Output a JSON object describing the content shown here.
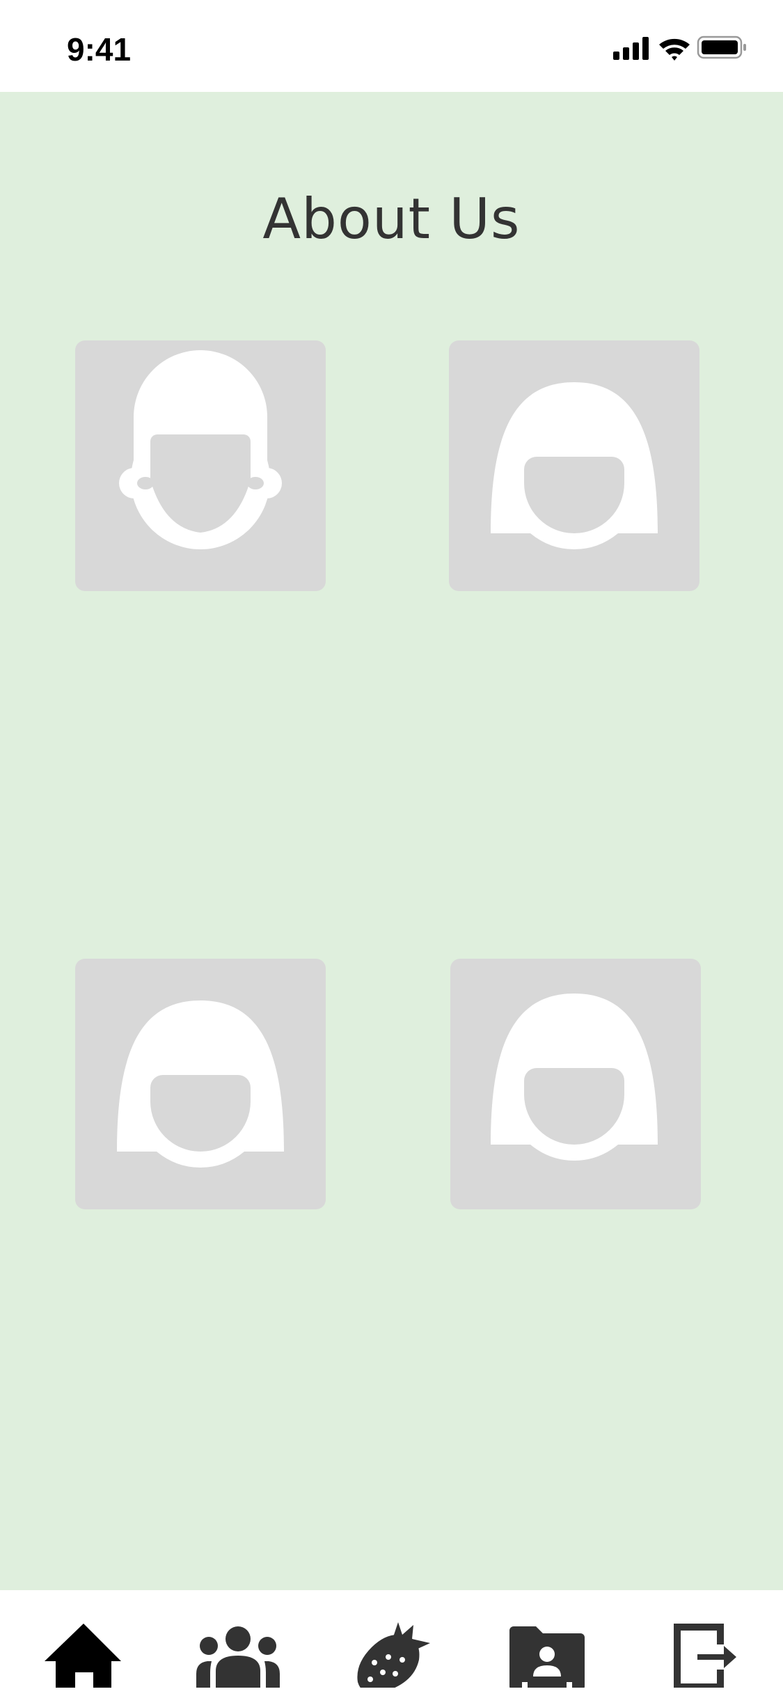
{
  "status_bar": {
    "time": "9:41"
  },
  "page": {
    "title": "About Us",
    "background_color": "#DFEFDD",
    "card_color": "#D8D8D8"
  },
  "team": [
    {
      "avatar": "male-avatar-icon"
    },
    {
      "avatar": "female-avatar-icon"
    },
    {
      "avatar": "female-avatar-icon"
    },
    {
      "avatar": "female-avatar-icon"
    }
  ],
  "tab_bar": {
    "items": [
      {
        "icon": "home-icon",
        "active": true
      },
      {
        "icon": "group-icon",
        "active": false
      },
      {
        "icon": "strawberry-icon",
        "active": false
      },
      {
        "icon": "contact-folder-icon",
        "active": false
      },
      {
        "icon": "logout-icon",
        "active": false
      }
    ]
  }
}
